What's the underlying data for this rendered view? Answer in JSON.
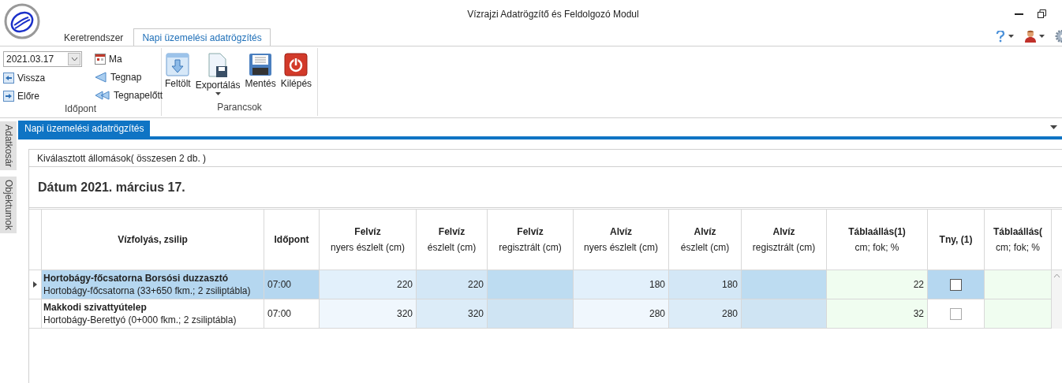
{
  "window": {
    "title": "Vízrajzi Adatrögzítő és Feldolgozó Modul"
  },
  "ribbon_tabs": [
    {
      "label": "Keretrendszer",
      "selected": false
    },
    {
      "label": "Napi üzemelési adatrögzítés",
      "selected": true
    }
  ],
  "ribbon_groups": [
    {
      "kind": "date",
      "label": "Időpont",
      "date_value": "2021.03.17",
      "nav": [
        {
          "kind": "back",
          "label": "Vissza"
        },
        {
          "kind": "forward",
          "label": "Előre"
        }
      ],
      "quick": [
        {
          "kind": "today",
          "label": "Ma"
        },
        {
          "kind": "yesterday",
          "label": "Tegnap"
        },
        {
          "kind": "daybefore",
          "label": "Tegnapelőtt"
        }
      ]
    },
    {
      "kind": "commands",
      "label": "Parancsok",
      "buttons": [
        {
          "kind": "upload",
          "label": "Feltölt",
          "dropdown": false
        },
        {
          "kind": "export",
          "label": "Exportálás",
          "dropdown": true
        },
        {
          "kind": "save",
          "label": "Mentés",
          "dropdown": false
        },
        {
          "kind": "exit",
          "label": "Kilépés",
          "dropdown": false
        }
      ]
    }
  ],
  "side_tabs": [
    {
      "label": "Adatkosár"
    },
    {
      "label": "Objektumok"
    }
  ],
  "document_tab": {
    "label": "Napi üzemelési adatrögzítés",
    "selected": true
  },
  "panel": {
    "header": "Kiválasztott állomások( összesen 2 db. )",
    "date_title": "Dátum 2021. március 17."
  },
  "table": {
    "columns": [
      {
        "kind": "name",
        "title": "Vízfolyás, zsilip"
      },
      {
        "kind": "time",
        "title": "Időpont"
      },
      {
        "kind": "raw",
        "title": "Felvíz",
        "subtitle": "nyers észlelt (cm)"
      },
      {
        "kind": "observed",
        "title": "Felvíz",
        "subtitle": "észlelt (cm)"
      },
      {
        "kind": "registered",
        "title": "Felvíz",
        "subtitle": "regisztrált (cm)"
      },
      {
        "kind": "raw",
        "title": "Alvíz",
        "subtitle": "nyers észlelt (cm)"
      },
      {
        "kind": "observed",
        "title": "Alvíz",
        "subtitle": "észlelt (cm)"
      },
      {
        "kind": "registered",
        "title": "Alvíz",
        "subtitle": "regisztrált (cm)"
      },
      {
        "kind": "gate",
        "title": "Táblaállás(1)",
        "subtitle": "cm; fok; %"
      },
      {
        "kind": "flag",
        "title": "Tny, (1)"
      },
      {
        "kind": "gate",
        "title": "Táblaállás(",
        "subtitle": "cm; fok; %"
      }
    ],
    "rows": [
      {
        "selected": true,
        "cells": [
          {
            "name": "Hortobágy-főcsatorna Borsósi duzzasztó",
            "location": "Hortobágy-főcsatorna (33+650 fkm.; 2 zsiliptábla)"
          },
          "07:00",
          "220",
          "220",
          "",
          "180",
          "180",
          "",
          "22",
          false,
          ""
        ]
      },
      {
        "selected": false,
        "cells": [
          {
            "name": "Makkodi szivattyútelep",
            "location": "Hortobágy-Berettyó (0+000 fkm.; 2 zsiliptábla)"
          },
          "07:00",
          "320",
          "320",
          "",
          "280",
          "280",
          "",
          "32",
          false,
          ""
        ]
      }
    ]
  }
}
